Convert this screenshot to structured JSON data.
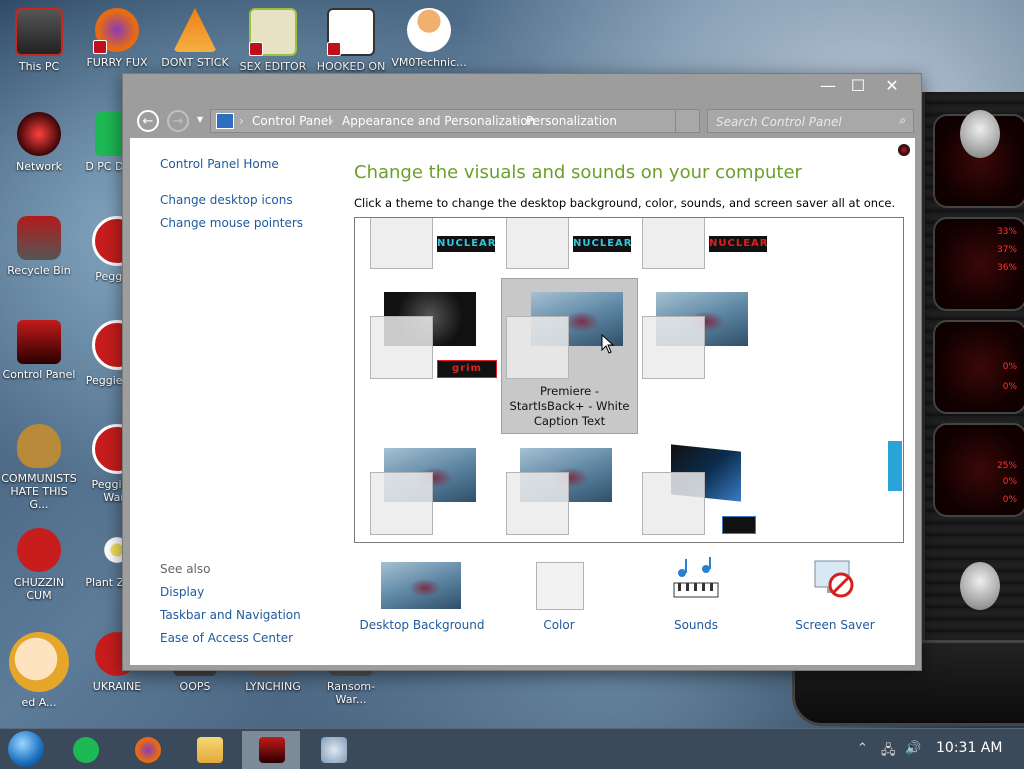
{
  "desktop": {
    "icons": [
      {
        "label": "This PC",
        "color": "#c9261f"
      },
      {
        "label": "FURRY FUX",
        "color": "#e66b14"
      },
      {
        "label": "DONT STICK",
        "color": "#f07e18"
      },
      {
        "label": "SEX EDITOR",
        "color": "#9ac23b"
      },
      {
        "label": "HOOKED ON",
        "color": "#333333"
      },
      {
        "label": "VM0Technic...",
        "color": "#e08c3a"
      },
      {
        "label": "Network",
        "color": "#7a1111"
      },
      {
        "label": "D PC DUMB",
        "color": "#1db954"
      },
      {
        "label": "Recycle Bin",
        "color": "#b21a1a"
      },
      {
        "label": "Peggie I",
        "color": "#c81d1d"
      },
      {
        "label": "Control Panel",
        "color": "#c31a1a"
      },
      {
        "label": "Peggie Deu",
        "color": "#c81d1d"
      },
      {
        "label": "COMMUNISTS HATE THIS G...",
        "color": "#b88a3a"
      },
      {
        "label": "Peggie of Wars",
        "color": "#c81d1d"
      },
      {
        "label": "CHUZZIN CUM",
        "color": "#c81d1d"
      },
      {
        "label": "Plant Zomb",
        "color": "#2e8b2e"
      },
      {
        "label": "ed A...",
        "color": "#e5a62a"
      },
      {
        "label": "UKRAINE",
        "color": "#c81d1d"
      },
      {
        "label": "OOPS",
        "color": "#444444"
      },
      {
        "label": "LYNCHING",
        "color": "#666666"
      },
      {
        "label": "Ransom-War...",
        "color": "#555555"
      }
    ]
  },
  "widget": {
    "readouts": [
      "33%",
      "37%",
      "36%",
      "0%",
      "0%",
      "25%",
      "0%",
      "0%"
    ]
  },
  "window": {
    "controls": {
      "minimize": "—",
      "maximize": "☐",
      "close": "✕"
    },
    "nav": {
      "back": "←",
      "forward": "→",
      "dropdown": "▾"
    },
    "breadcrumb": [
      "Control Panel",
      "Appearance and Personalization",
      "Personalization"
    ],
    "search_placeholder": "Search Control Panel",
    "left_pane": {
      "home": "Control Panel Home",
      "links": [
        "Change desktop icons",
        "Change mouse pointers"
      ],
      "see_also_title": "See also",
      "see_also": [
        "Display",
        "Taskbar and Navigation",
        "Ease of Access Center"
      ]
    },
    "heading": "Change the visuals and sounds on your computer",
    "subheading": "Click a theme to change the desktop background, color, sounds, and screen saver all at once.",
    "themes": [
      {
        "badge": "NUCLEAR",
        "badge_color": "#33c4e0",
        "style": "light"
      },
      {
        "badge": "NUCLEAR",
        "badge_color": "#33c4e0",
        "style": "light"
      },
      {
        "badge": "NUCLEAR",
        "badge_color": "#e02020",
        "style": "light"
      },
      {
        "badge": "grim",
        "badge_color": "#e02020",
        "style": "dark"
      },
      {
        "caption": "Premiere - StartIsBack+ - White Caption Text",
        "style": "light",
        "selected": true
      },
      {
        "style": "light"
      },
      {
        "style": "light"
      },
      {
        "style": "light"
      },
      {
        "style": "blue"
      }
    ],
    "bottom_bar": [
      {
        "label": "Desktop Background"
      },
      {
        "label": "Color"
      },
      {
        "label": "Sounds"
      },
      {
        "label": "Screen Saver"
      }
    ]
  },
  "taskbar": {
    "clock": "10:31 AM",
    "tray_icons": [
      "chevron-up",
      "network",
      "volume"
    ]
  }
}
